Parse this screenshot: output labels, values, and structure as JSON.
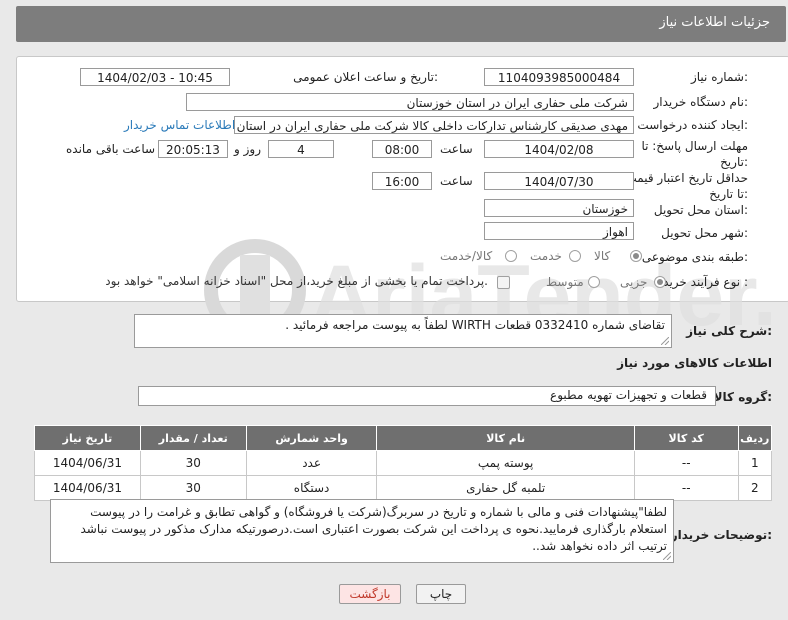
{
  "header": {
    "title": "جزئیات اطلاعات نیاز"
  },
  "form": {
    "need_number_label": "شماره نیاز:",
    "need_number": "1104093985000484",
    "announce_label": "تاریخ و ساعت اعلان عمومی:",
    "announce_value": "1404/02/03 - 10:45",
    "buyer_org_label": "نام دستگاه خریدار:",
    "buyer_org": "شرکت ملی حفاری ایران در استان خوزستان",
    "requester_label": "ایجاد کننده درخواست:",
    "requester": "مهدی صدیقی کارشناس تدارکات داخلی کالا شرکت ملی حفاری ایران در استان",
    "contact_link": "اطلاعات تماس خریدار",
    "deadline_label": "مهلت ارسال پاسخ: تا تاریخ:",
    "deadline_date": "1404/02/08",
    "time_label": "ساعت",
    "deadline_time": "08:00",
    "days_value": "4",
    "days_label": "روز و",
    "remaining_time": "20:05:13",
    "remaining_label": "ساعت باقی مانده",
    "price_validity_label": "حداقل تاریخ اعتبار قیمت: تا تاریخ:",
    "price_validity_date": "1404/07/30",
    "price_validity_time": "16:00",
    "province_label": "استان محل تحویل:",
    "province": "خوزستان",
    "city_label": "شهر محل تحویل:",
    "city": "اهواز",
    "category_label": "طبقه بندی موضوعی:",
    "category_options": [
      "کالا",
      "خدمت",
      "کالا/خدمت"
    ],
    "process_label": "نوع فرآیند خرید :",
    "process_options": [
      "جزیی",
      "متوسط"
    ],
    "payment_note": "پرداخت تمام یا بخشی از مبلغ خرید،از محل \"اسناد خزانه اسلامی\" خواهد بود."
  },
  "description": {
    "label": "شرح کلی نیاز:",
    "text": "تقاضای شماره 0332410 قطعات WIRTH لطفاً به پیوست مراجعه فرمائید ."
  },
  "goods": {
    "section_title": "اطلاعات کالاهای مورد نیاز",
    "group_label": "گروه کالا:",
    "group_value": "قطعات و تجهیزات تهویه مطبوع"
  },
  "table": {
    "headers": [
      "ردیف",
      "کد کالا",
      "نام کالا",
      "واحد شمارش",
      "تعداد / مقدار",
      "تاریخ نیاز"
    ],
    "rows": [
      [
        "1",
        "--",
        "پوسته پمپ",
        "عدد",
        "30",
        "1404/06/31"
      ],
      [
        "2",
        "--",
        "تلمبه گل حفاری",
        "دستگاه",
        "30",
        "1404/06/31"
      ]
    ]
  },
  "notes": {
    "label": "توضیحات خریدار:",
    "text": "لطفا\"پیشنهادات فنی و مالی با شماره و تاریخ در سربرگ(شرکت یا فروشگاه) و گواهی تطابق و غرامت را در پیوست استعلام بارگذاری فرمایید.نحوه ی پرداخت این شرکت بصورت اعتباری است.درصورتیکه مدارک مذکور در پیوست نباشد ترتیب اثر داده نخواهد شد.."
  },
  "buttons": {
    "print": "چاپ",
    "back": "بازگشت"
  },
  "watermark": {
    "text": "AriaTender.net"
  },
  "colors": {
    "header_bg": "#7d7d7d",
    "table_header_bg": "#6f6f6f",
    "link": "#2a7ab9",
    "back_button_text": "#c0392b"
  }
}
